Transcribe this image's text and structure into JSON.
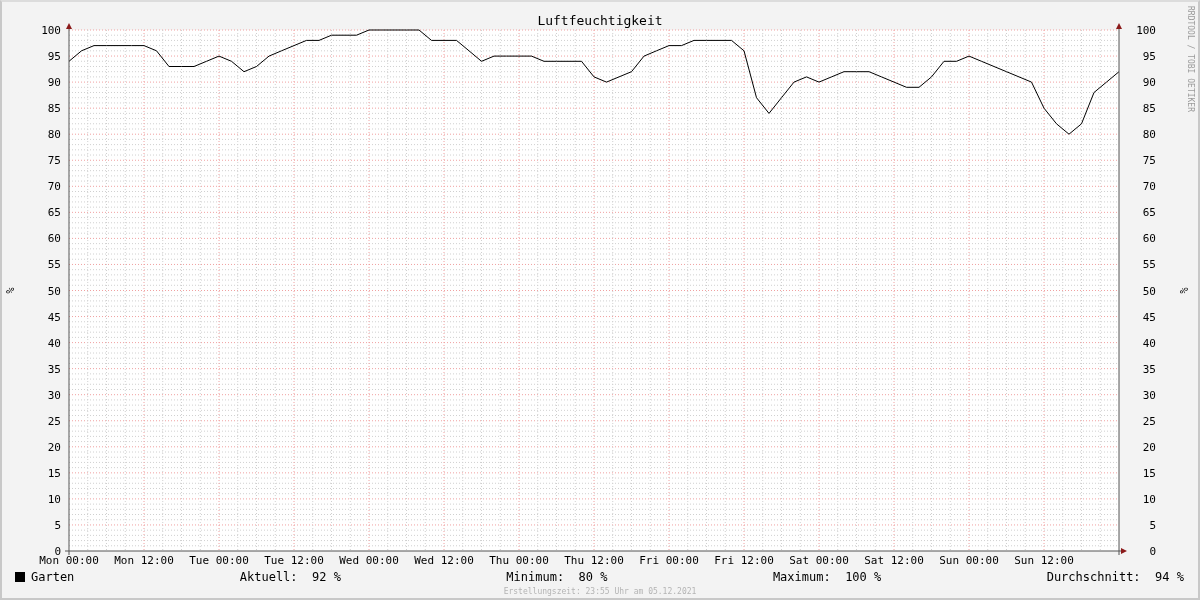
{
  "chart": {
    "watermark": "RRDTOOL / TOBI OETIKER",
    "right_axis": {
      "ylabel": "%",
      "ticks": [
        "100",
        "95",
        "90",
        "85",
        "80",
        "75",
        "70",
        "65",
        "60",
        "55",
        "50",
        "45",
        "40",
        "35",
        "30",
        "25",
        "20",
        "15",
        "10",
        "5",
        "0"
      ]
    },
    "chart_data": {
      "type": "line",
      "title": "Luftfeuchtigkeit",
      "ylabel": "%",
      "categories": [
        "Mon 00:00",
        null,
        null,
        null,
        null,
        null,
        "Mon 12:00",
        null,
        null,
        null,
        null,
        null,
        "Tue 00:00",
        null,
        null,
        null,
        null,
        null,
        "Tue 12:00",
        null,
        null,
        null,
        null,
        null,
        "Wed 00:00",
        null,
        null,
        null,
        null,
        null,
        "Wed 12:00",
        null,
        null,
        null,
        null,
        null,
        "Thu 00:00",
        null,
        null,
        null,
        null,
        null,
        "Thu 12:00",
        null,
        null,
        null,
        null,
        null,
        "Fri 00:00",
        null,
        null,
        null,
        null,
        null,
        "Fri 12:00",
        null,
        null,
        null,
        null,
        null,
        "Sat 00:00",
        null,
        null,
        null,
        null,
        null,
        "Sat 12:00",
        null,
        null,
        null,
        null,
        null,
        "Sun 00:00",
        null,
        null,
        null,
        null,
        null,
        "Sun 12:00",
        null,
        null,
        null,
        null,
        null,
        null
      ],
      "series": [
        {
          "name": "Garten",
          "color": "#000000",
          "values": [
            94,
            96,
            97,
            97,
            97,
            97,
            97,
            96,
            93,
            93,
            93,
            94,
            95,
            94,
            92,
            93,
            95,
            96,
            97,
            98,
            98,
            99,
            99,
            99,
            100,
            100,
            100,
            100,
            100,
            98,
            98,
            98,
            96,
            94,
            95,
            95,
            95,
            95,
            94,
            94,
            94,
            94,
            91,
            90,
            91,
            92,
            95,
            96,
            97,
            97,
            98,
            98,
            98,
            98,
            96,
            87,
            84,
            87,
            90,
            91,
            90,
            91,
            92,
            92,
            92,
            91,
            90,
            89,
            89,
            91,
            94,
            94,
            95,
            94,
            93,
            92,
            91,
            90,
            85,
            82,
            80,
            82,
            88,
            90,
            92
          ]
        }
      ],
      "ylim": [
        0,
        100
      ],
      "grid": true,
      "yticks": [
        0,
        5,
        10,
        15,
        20,
        25,
        30,
        35,
        40,
        45,
        50,
        55,
        60,
        65,
        70,
        75,
        80,
        85,
        90,
        95,
        100
      ]
    }
  },
  "legend": {
    "stats": [
      {
        "label": "Aktuell:",
        "value": "92 %"
      },
      {
        "label": "Minimum:",
        "value": "80 %"
      },
      {
        "label": "Maximum:",
        "value": "100 %"
      },
      {
        "label": "Durchschnitt:",
        "value": "94 %"
      }
    ],
    "footer": "Erstellungszeit: 23:55 Uhr am 05.12.2021"
  }
}
